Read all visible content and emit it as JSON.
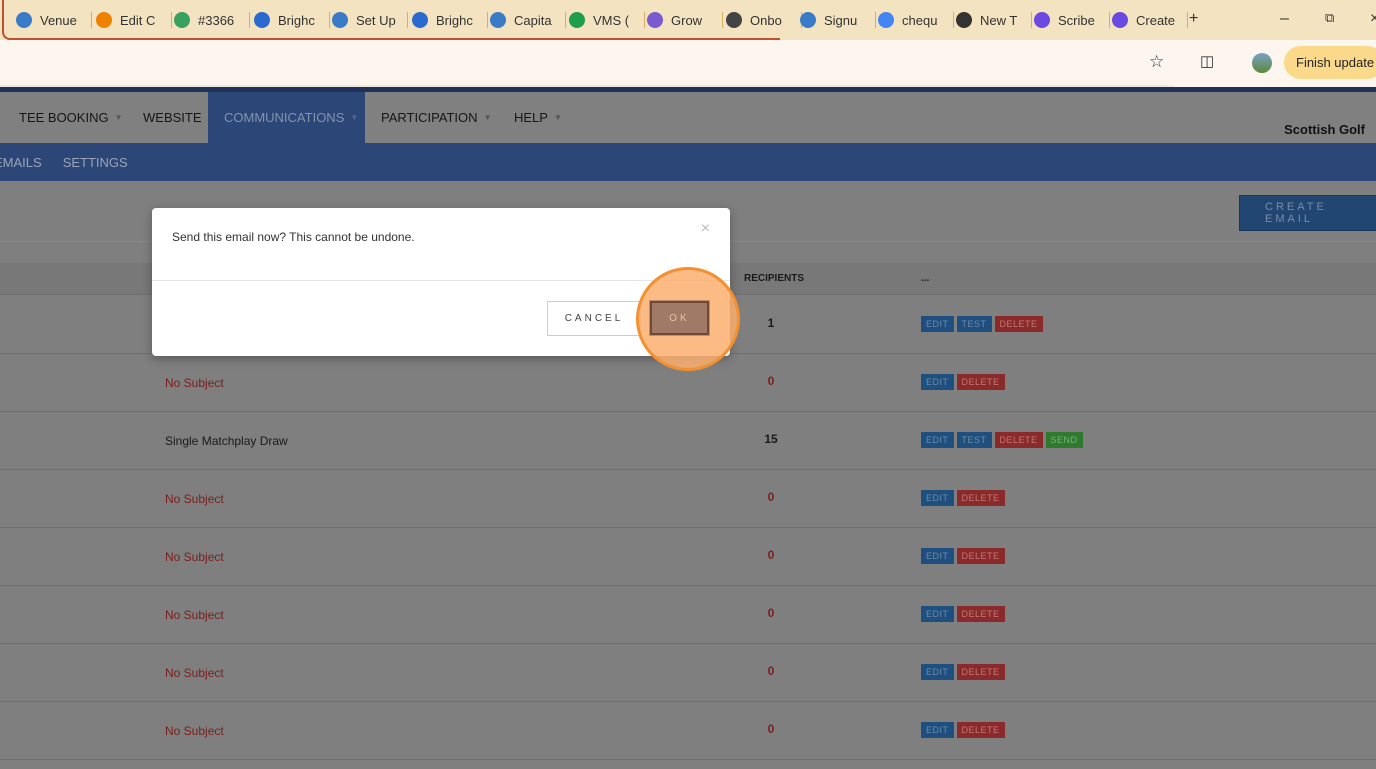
{
  "browser": {
    "tabs": [
      {
        "label": "Venue",
        "icon": "golf-icon",
        "color": "#3a7bc8"
      },
      {
        "label": "Edit C",
        "icon": "a-icon",
        "color": "#f08000"
      },
      {
        "label": "#3366",
        "icon": "ticket-icon",
        "color": "#3aa060"
      },
      {
        "label": "Brighc",
        "icon": "link-icon",
        "color": "#2a6ad0"
      },
      {
        "label": "Set Up",
        "icon": "golf-icon",
        "color": "#3a7bc8"
      },
      {
        "label": "Brighc",
        "icon": "link-icon",
        "color": "#2a6ad0"
      },
      {
        "label": "Capita",
        "icon": "golf-icon",
        "color": "#3a7bc8"
      },
      {
        "label": "VMS (",
        "icon": "sheet-icon",
        "color": "#1e9e48"
      },
      {
        "label": "Grow",
        "icon": "dots-icon",
        "color": "#7a5ad0"
      },
      {
        "label": "Onbo",
        "icon": "globe-icon",
        "color": "#444444"
      },
      {
        "label": "Signu",
        "icon": "golf-icon",
        "color": "#3a7bc8"
      },
      {
        "label": "chequ",
        "icon": "google-icon",
        "color": "#4285f4"
      },
      {
        "label": "New T",
        "icon": "chrome-icon",
        "color": "#333333"
      },
      {
        "label": "Scribe",
        "icon": "scribe-icon",
        "color": "#6a4ae0"
      },
      {
        "label": "Create",
        "icon": "scribe-icon",
        "color": "#6a4ae0"
      }
    ],
    "new_tab": "+",
    "finish_update": "Finish update"
  },
  "nav": {
    "items": [
      {
        "label": "TEE BOOKING",
        "caret": true
      },
      {
        "label": "WEBSITE",
        "caret": false
      },
      {
        "label": "COMMUNICATIONS",
        "caret": true,
        "active": true
      },
      {
        "label": "PARTICIPATION",
        "caret": true
      },
      {
        "label": "HELP",
        "caret": true
      }
    ],
    "org": "Scottish Golf",
    "sub": [
      "EMAILS",
      "SETTINGS"
    ]
  },
  "create_email": "CREATE EMAIL",
  "table": {
    "headers": {
      "recipients": "RECIPIENTS",
      "actions": "..."
    },
    "rows": [
      {
        "subject": "",
        "recipients": "1",
        "actions": [
          "EDIT",
          "TEST",
          "DELETE"
        ]
      },
      {
        "subject": "No Subject",
        "recipients": "0",
        "actions": [
          "EDIT",
          "DELETE"
        ]
      },
      {
        "subject": "Single Matchplay Draw",
        "recipients": "15",
        "actions": [
          "EDIT",
          "TEST",
          "DELETE",
          "SEND"
        ]
      },
      {
        "subject": "No Subject",
        "recipients": "0",
        "actions": [
          "EDIT",
          "DELETE"
        ]
      },
      {
        "subject": "No Subject",
        "recipients": "0",
        "actions": [
          "EDIT",
          "DELETE"
        ]
      },
      {
        "subject": "No Subject",
        "recipients": "0",
        "actions": [
          "EDIT",
          "DELETE"
        ]
      },
      {
        "subject": "No Subject",
        "recipients": "0",
        "actions": [
          "EDIT",
          "DELETE"
        ]
      },
      {
        "subject": "No Subject",
        "recipients": "0",
        "actions": [
          "EDIT",
          "DELETE"
        ]
      }
    ]
  },
  "modal": {
    "message": "Send this email now? This cannot be undone.",
    "close": "×",
    "cancel": "CANCEL",
    "ok": "OK"
  }
}
